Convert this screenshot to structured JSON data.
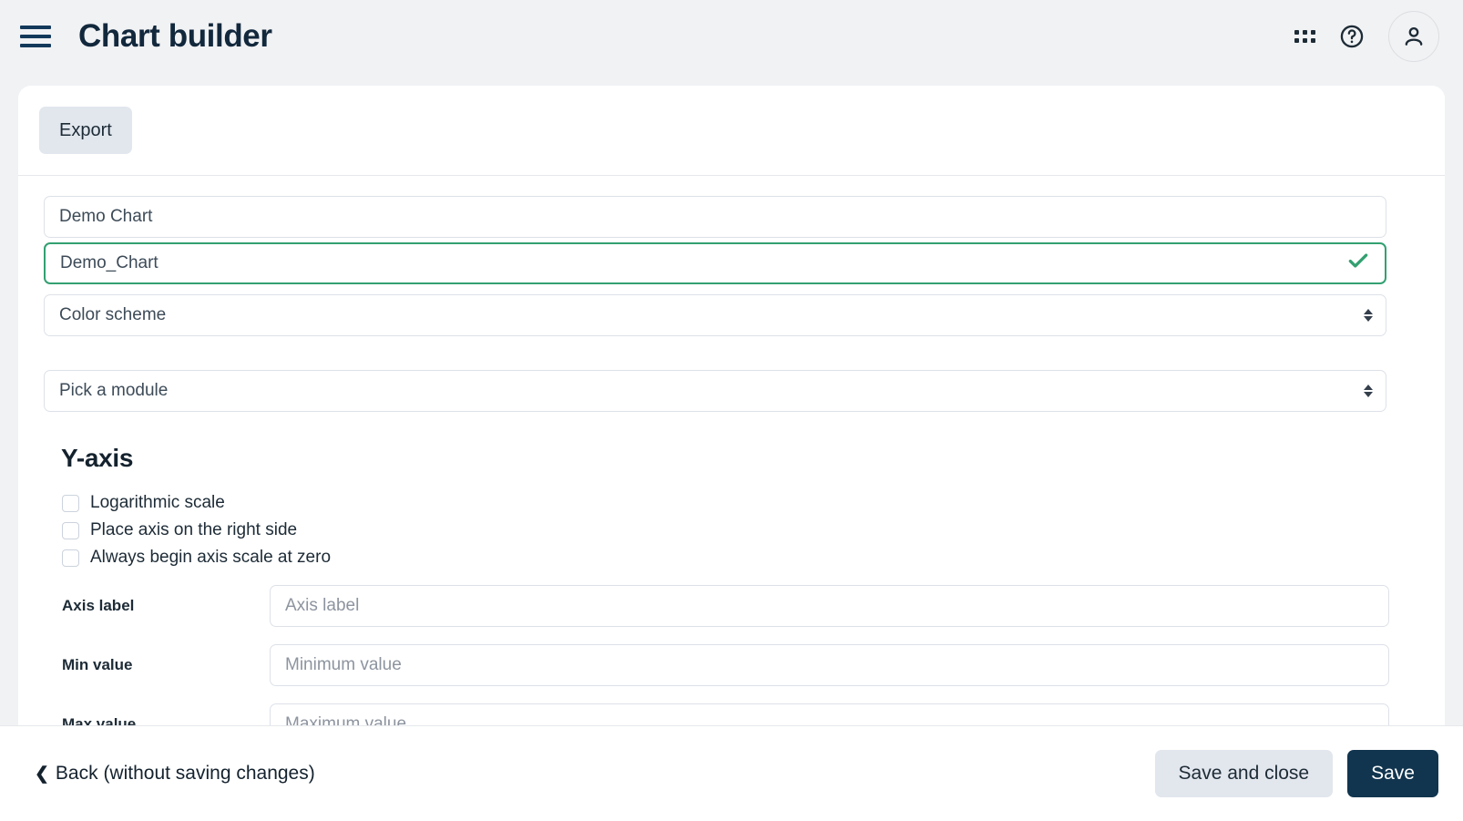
{
  "header": {
    "title": "Chart builder",
    "menu_icon": "hamburger-menu-icon",
    "apps_icon": "grid-apps-icon",
    "help_icon": "help-circle-icon",
    "avatar_icon": "user-avatar-icon"
  },
  "toolbar": {
    "export_label": "Export"
  },
  "form": {
    "chart_title": {
      "value": "Demo Chart",
      "placeholder": "Demo Chart"
    },
    "chart_identifier": {
      "value": "Demo_Chart",
      "placeholder": "Demo_Chart",
      "valid": true,
      "valid_icon": "check-icon"
    },
    "color_scheme": {
      "selected": "Color scheme"
    },
    "module": {
      "selected": "Pick a module"
    }
  },
  "yaxis": {
    "heading": "Y-axis",
    "checkboxes": [
      {
        "label": "Logarithmic scale",
        "checked": false
      },
      {
        "label": "Place axis on the right side",
        "checked": false
      },
      {
        "label": "Always begin axis scale at zero",
        "checked": false
      }
    ],
    "rows": [
      {
        "label": "Axis label",
        "placeholder": "Axis label",
        "value": ""
      },
      {
        "label": "Min value",
        "placeholder": "Minimum value",
        "value": ""
      },
      {
        "label": "Max value",
        "placeholder": "Maximum value",
        "value": ""
      }
    ]
  },
  "footer": {
    "back_label": "Back (without saving changes)",
    "back_chevron": "‹",
    "save_and_close_label": "Save and close",
    "save_label": "Save"
  },
  "colors": {
    "page_background": "#f1f2f4",
    "card_background": "#ffffff",
    "primary_dark": "#11354f",
    "valid_green": "#33a071",
    "muted_button": "#e2e6ed"
  }
}
